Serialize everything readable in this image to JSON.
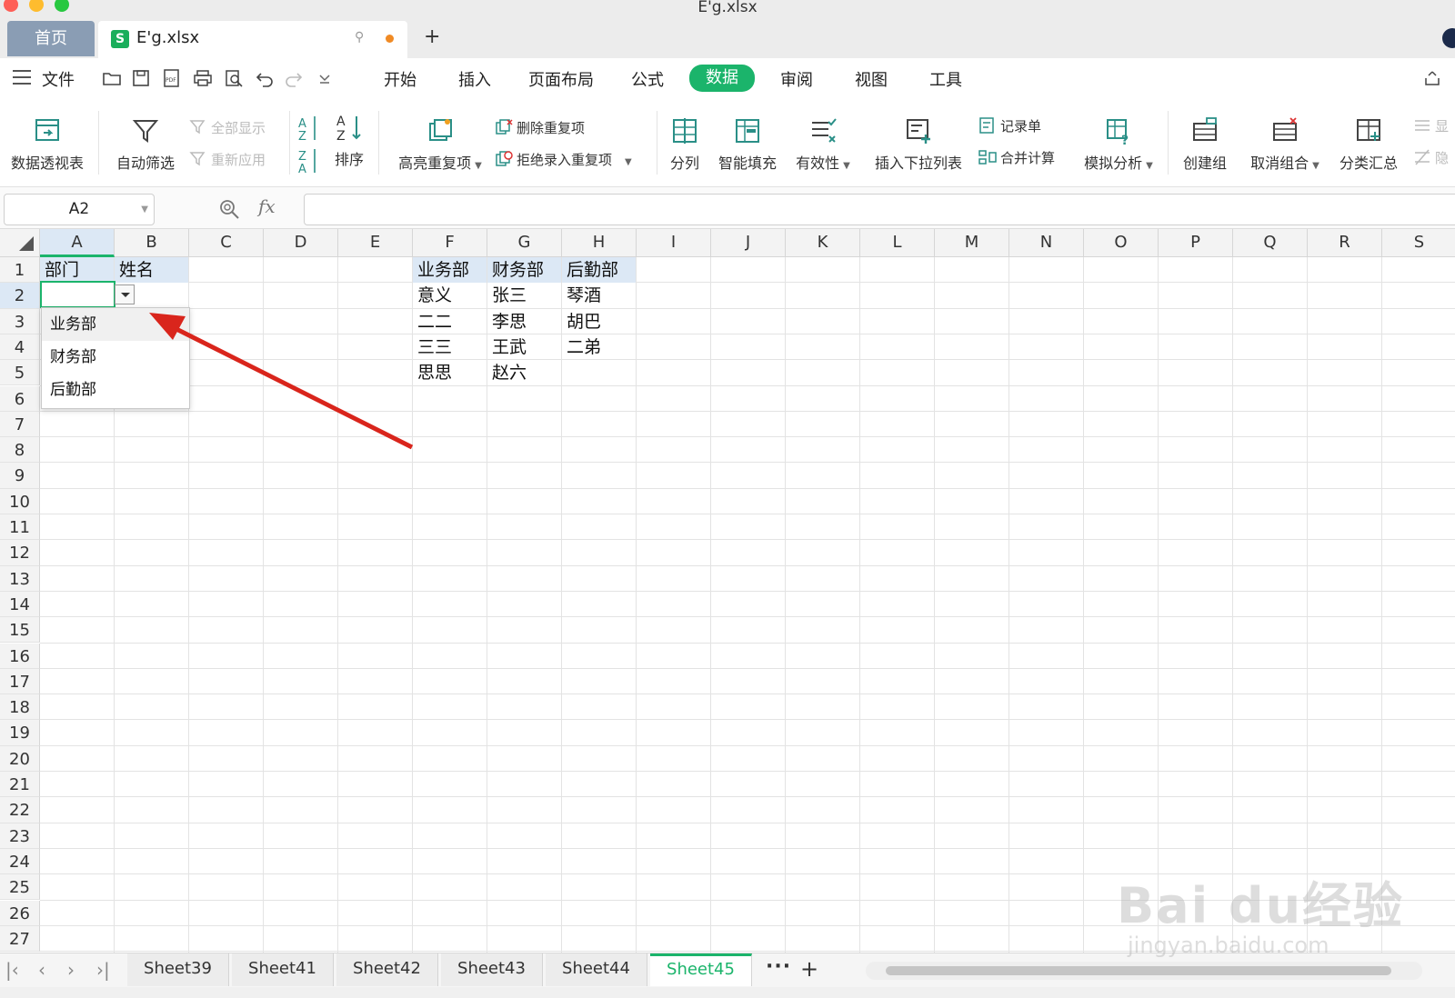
{
  "window": {
    "title": "E'g.xlsx"
  },
  "tabs": {
    "home": "首页",
    "file": "E'g.xlsx",
    "add": "+"
  },
  "menu": {
    "file": "文件",
    "tabs": [
      "开始",
      "插入",
      "页面布局",
      "公式",
      "数据",
      "审阅",
      "视图",
      "工具"
    ],
    "active_tab": "数据"
  },
  "ribbon": {
    "pivot": "数据透视表",
    "autofilter": "自动筛选",
    "show_all": "全部显示",
    "reapply": "重新应用",
    "sort": "排序",
    "highlight_dup": "高亮重复项",
    "remove_dup": "删除重复项",
    "reject_dup": "拒绝录入重复项",
    "split": "分列",
    "smart_fill": "智能填充",
    "validity": "有效性",
    "insert_dropdown": "插入下拉列表",
    "record": "记录单",
    "consolidate": "合并计算",
    "what_if": "模拟分析",
    "group": "创建组",
    "ungroup": "取消组合",
    "subtotal": "分类汇总",
    "show_partial": "显",
    "hide_partial": "隐"
  },
  "formula_bar": {
    "name_box": "A2",
    "fx": "fx",
    "value": ""
  },
  "grid": {
    "columns": [
      "A",
      "B",
      "C",
      "D",
      "E",
      "F",
      "G",
      "H",
      "I",
      "J",
      "K",
      "L",
      "M",
      "N",
      "O",
      "P",
      "Q",
      "R",
      "S"
    ],
    "rows": [
      "1",
      "2",
      "3",
      "4",
      "5",
      "6",
      "7",
      "8",
      "9",
      "10",
      "11",
      "12",
      "13",
      "14",
      "15",
      "16",
      "17",
      "18",
      "19",
      "20",
      "21",
      "22",
      "23",
      "24",
      "25",
      "26",
      "27"
    ],
    "cells": {
      "A1": "部门",
      "B1": "姓名",
      "F1": "业务部",
      "G1": "财务部",
      "H1": "后勤部",
      "F2": "意义",
      "G2": "张三",
      "H2": "琴酒",
      "F3": "二二",
      "G3": "李思",
      "H3": "胡巴",
      "F4": "三三",
      "G4": "王武",
      "H4": "二弟",
      "F5": "思思",
      "G5": "赵六"
    },
    "dropdown_options": [
      "业务部",
      "财务部",
      "后勤部"
    ]
  },
  "sheets": {
    "tabs": [
      "Sheet39",
      "Sheet41",
      "Sheet42",
      "Sheet43",
      "Sheet44",
      "Sheet45"
    ],
    "active": "Sheet45",
    "more": "···",
    "add": "+"
  },
  "watermark": {
    "brand": "Bai du经验",
    "url": "jingyan.baidu.com"
  },
  "colors": {
    "accent": "#1bb46b",
    "selection": "#dce8f5",
    "annotation_arrow": "#d9251c"
  }
}
